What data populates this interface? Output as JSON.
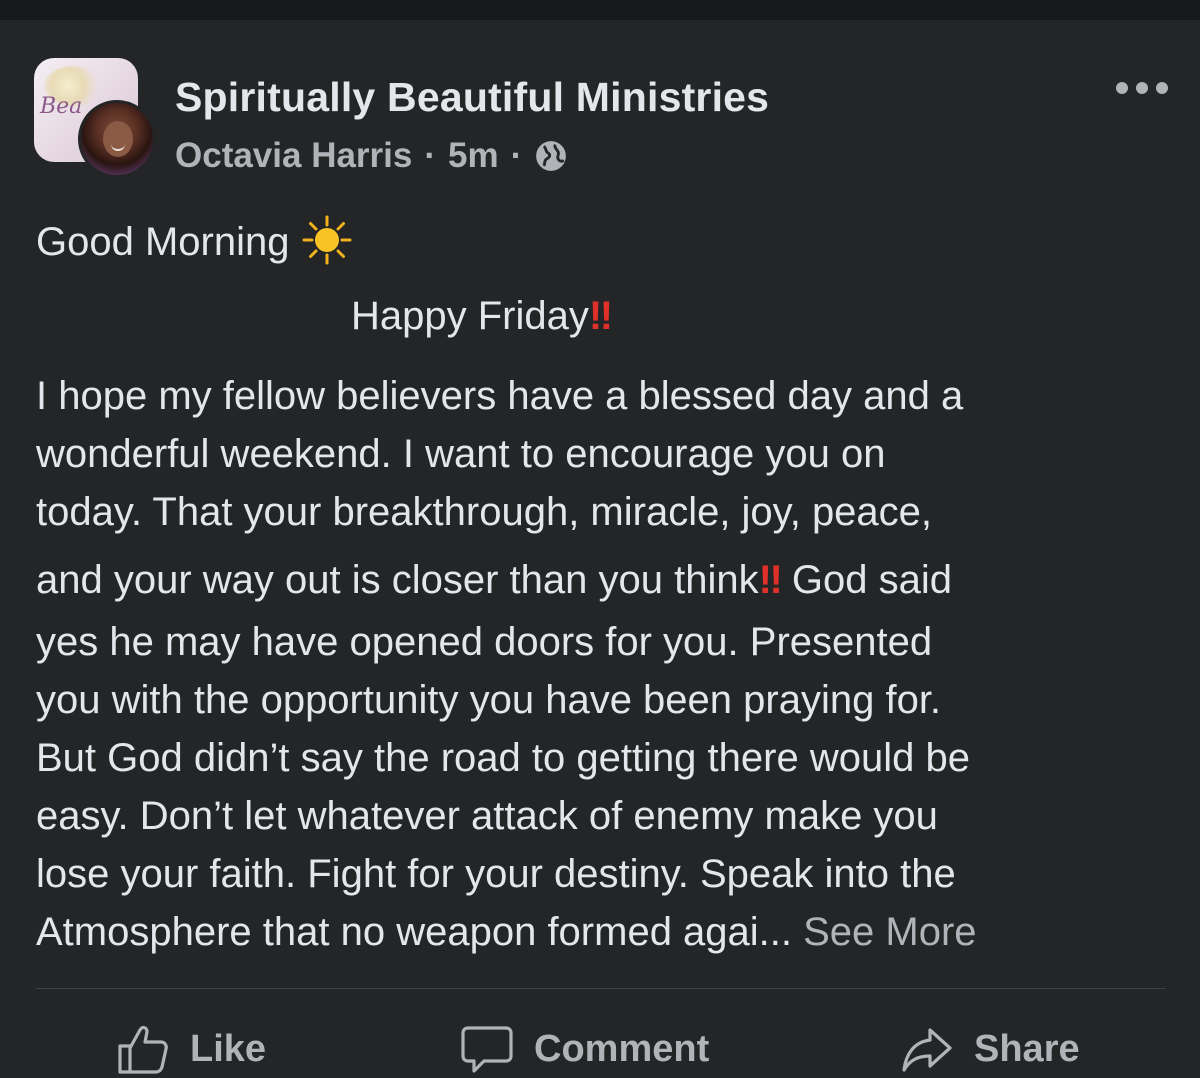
{
  "post": {
    "page_name": "Spiritually Beautiful Ministries",
    "group_pic_text": "Bea",
    "author": "Octavia Harris",
    "separator": "·",
    "time": "5m",
    "privacy_icon": "globe-icon",
    "more_icon": "more-options-icon"
  },
  "body": {
    "greeting": "Good Morning",
    "greeting_emoji": "sun-emoji",
    "friday": "Happy Friday",
    "bang_emoji": "‼",
    "lines": [
      "I hope my fellow believers have a blessed day and a",
      "wonderful weekend. I want to encourage you on",
      "today. That your breakthrough, miracle, joy, peace,",
      "and your way out is closer than you think",
      " God said",
      "yes he may have opened doors for you. Presented",
      "you with the opportunity you have been praying for.",
      "But God didn’t say the road to getting there would be",
      "easy. Don’t let whatever attack of enemy make you",
      "lose your faith. Fight for your destiny. Speak into the",
      "Atmosphere that no weapon formed agai..."
    ],
    "see_more": " See More"
  },
  "actions": {
    "like": "Like",
    "comment": "Comment",
    "share": "Share",
    "like_icon": "thumbs-up-icon",
    "comment_icon": "comment-bubble-icon",
    "share_icon": "share-arrow-icon"
  },
  "colors": {
    "background": "#242526",
    "text": "#e4e6eb",
    "secondary_text": "#b0b3b8",
    "emphasis_red": "#e0302a"
  }
}
